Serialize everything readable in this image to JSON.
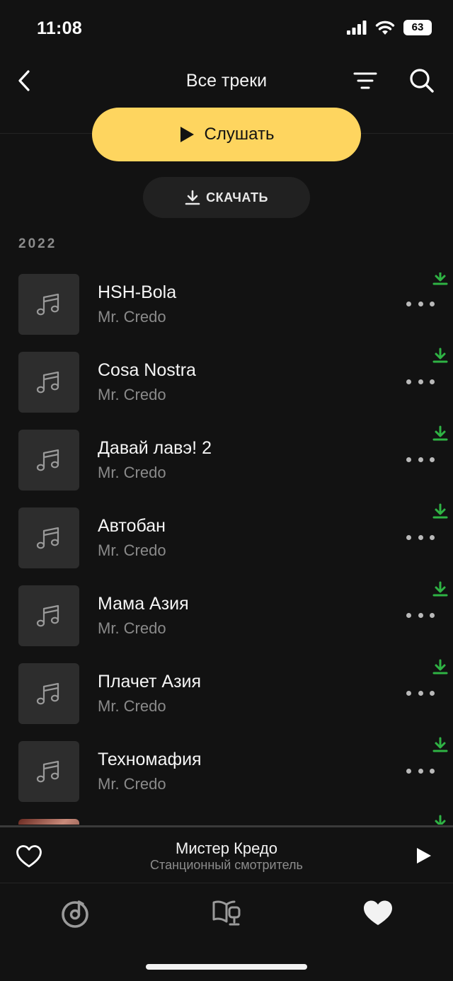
{
  "status_bar": {
    "time": "11:08",
    "battery": "63"
  },
  "header": {
    "title": "Все треки"
  },
  "actions": {
    "play_label": "Слушать",
    "download_label": "СКАЧАТЬ"
  },
  "section": {
    "year": "2022"
  },
  "tracks": [
    {
      "title": "HSH-Bola",
      "artist": "Mr. Credo"
    },
    {
      "title": "Cosa Nostra",
      "artist": "Mr. Credo"
    },
    {
      "title": "Давай лавэ! 2",
      "artist": "Mr. Credo"
    },
    {
      "title": "Автобан",
      "artist": "Mr. Credo"
    },
    {
      "title": "Мама Азия",
      "artist": "Mr. Credo"
    },
    {
      "title": "Плачет Азия",
      "artist": "Mr. Credo"
    },
    {
      "title": "Техномафия",
      "artist": "Mr. Credo"
    }
  ],
  "now_playing": {
    "title": "Мистер Кредо",
    "artist": "Станционный смотритель"
  },
  "colors": {
    "accent": "#fed55f",
    "downloaded": "#2fb344",
    "background": "#121212"
  },
  "icons": {
    "back": "chevron-left-icon",
    "filter": "filter-icon",
    "search": "search-icon",
    "play": "play-icon",
    "download": "download-icon",
    "music_note": "music-note-icon",
    "more": "more-icon",
    "heart": "heart-icon",
    "tab_radio": "radio-icon",
    "tab_podcasts": "podcast-icon",
    "tab_collection": "heart-filled-icon"
  }
}
